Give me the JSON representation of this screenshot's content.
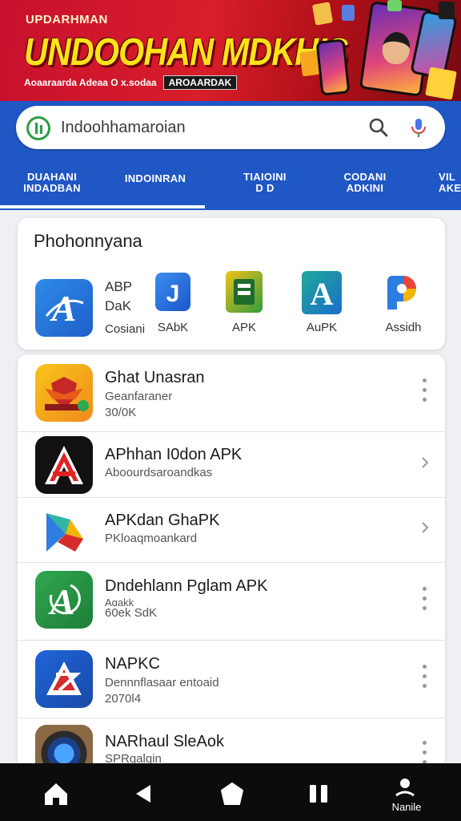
{
  "banner": {
    "top_text": "UPDARHMAN",
    "title": "UNDOOHAN MDKHIS",
    "subtitle": "Aoaaraarda Adeaa O x.sodaa",
    "pill": "AROAARDAK"
  },
  "search": {
    "value": "Indoohhamaroian",
    "icons": [
      "app-logo-icon",
      "search-icon",
      "mic-icon"
    ]
  },
  "tabs": [
    {
      "label": "DUAHANI\nINDADBAN"
    },
    {
      "label": "INDOINRAN"
    },
    {
      "label": "TIAIOINI\nD D"
    },
    {
      "label": "CODANI\nADKINI"
    },
    {
      "label": "VIL\nAKE"
    }
  ],
  "featured": {
    "title": "Phohonnyana",
    "apps": [
      {
        "line1": "ABP",
        "line2": "DaK",
        "line3": "Cosiani",
        "icon": "a-blue-icon"
      },
      {
        "label": "SAbK",
        "icon": "j-blue-icon"
      },
      {
        "label": "APK",
        "icon": "book-green-icon"
      },
      {
        "label": "AuPK",
        "icon": "a-teal-icon"
      },
      {
        "label": "Assidh",
        "icon": "p-multicolor-icon"
      }
    ]
  },
  "list": [
    {
      "title": "Ghat Unasran",
      "sub": "Geanfaraner",
      "sub2": "30/0K",
      "action": "more"
    },
    {
      "title": "APhhan I0don APK",
      "sub": "Aboourdsaroandkas",
      "sub2": "",
      "action": "chevron"
    },
    {
      "title": "APKdan GhaPK",
      "sub": "PKloaqmoankard",
      "sub2": "",
      "action": "chevron"
    },
    {
      "title": "Dndehlann Pɡlam APK",
      "sub": "Aɑakk",
      "sub2": "60ek SdK",
      "action": "more"
    },
    {
      "title": "NAPKC",
      "sub": "Dennnflasaar entoaid",
      "sub2": "2070l4",
      "action": "more"
    },
    {
      "title": "NARhaul SleAok",
      "sub": "SPRgalqin",
      "sub2": "",
      "action": "more"
    }
  ],
  "navbar": {
    "label": "Nanile",
    "buttons": [
      "home-icon",
      "back-icon",
      "home-pentagon-icon",
      "recents-icon",
      "profile-icon"
    ]
  },
  "colors": {
    "header": "#1f57c4",
    "banner": "#c8102e",
    "banner_title": "#ffe21a"
  }
}
